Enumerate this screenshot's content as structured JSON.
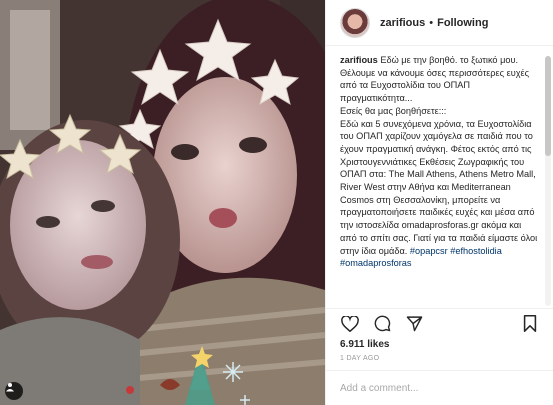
{
  "post": {
    "username": "zarifious",
    "separator": "•",
    "follow_status": "Following",
    "caption_username": "zarifious",
    "caption_text": "Εδώ με την βοηθό. το ξωτικό μου. Θέλουμε να κάνουμε όσες περισσότερες ευχές από τα Ευχοστολίδια του ΟΠΑΠ πραγματικότητα...\nΕσείς θα μας βοηθήσετε:::\nΕδώ και 5 συνεχόμενα χρόνια, τα Ευχοστολίδια του ΟΠΑΠ χαρίζουν  χαμόγελα σε παιδιά που το έχουν πραγματική ανάγκη. Φέτος εκτός από τις Χριστουγεννιάτικες Εκθέσεις Ζωγραφικής του ΟΠΑΠ στα: The Mall Athens, Athens Metro Mall, River West στην Αθήνα και Mediterranean Cosmos στη Θεσσαλονίκη, μπορείτε να πραγματοποιήσετε παιδικές ευχές και μέσα από την ιστοσελίδα omadaprosforas.gr ακόμα και από το σπίτι σας. Γιατί για τα παιδιά είμαστε όλοι στην ίδια ομάδα.",
    "hashtags": [
      "#opapcsr",
      "#efhostolidia",
      "#omadaprosforas"
    ],
    "likes": "6.911 likes",
    "time_ago": "1 DAY AGO",
    "comment_placeholder": "Add a comment..."
  },
  "icons": {
    "like": "heart-icon",
    "comment": "comment-icon",
    "share": "share-icon",
    "save": "bookmark-icon",
    "tag": "user-tag-icon"
  },
  "colors": {
    "link": "#003569",
    "meta": "#999999",
    "text": "#262626"
  }
}
